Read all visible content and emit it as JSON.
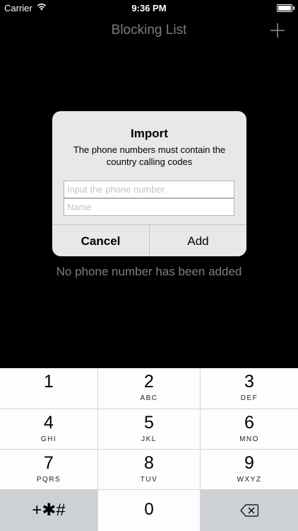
{
  "status_bar": {
    "carrier": "Carrier",
    "time": "9:36 PM"
  },
  "nav": {
    "title": "Blocking List"
  },
  "empty_message": "No phone number has been added",
  "dialog": {
    "title": "Import",
    "message": "The phone numbers must contain the country calling codes",
    "phone_placeholder": "Input the phone number",
    "name_placeholder": "Name",
    "cancel_label": "Cancel",
    "add_label": "Add"
  },
  "keypad": {
    "keys": [
      {
        "digit": "1",
        "letters": ""
      },
      {
        "digit": "2",
        "letters": "ABC"
      },
      {
        "digit": "3",
        "letters": "DEF"
      },
      {
        "digit": "4",
        "letters": "GHI"
      },
      {
        "digit": "5",
        "letters": "JKL"
      },
      {
        "digit": "6",
        "letters": "MNO"
      },
      {
        "digit": "7",
        "letters": "PQRS"
      },
      {
        "digit": "8",
        "letters": "TUV"
      },
      {
        "digit": "9",
        "letters": "WXYZ"
      }
    ],
    "symbols_label": "+✱#",
    "zero": "0",
    "delete_icon": "backspace-icon"
  },
  "colors": {
    "background": "#000000",
    "dialog_background": "#e8e8e8",
    "keyboard_dark_key": "#cdd1d6"
  }
}
